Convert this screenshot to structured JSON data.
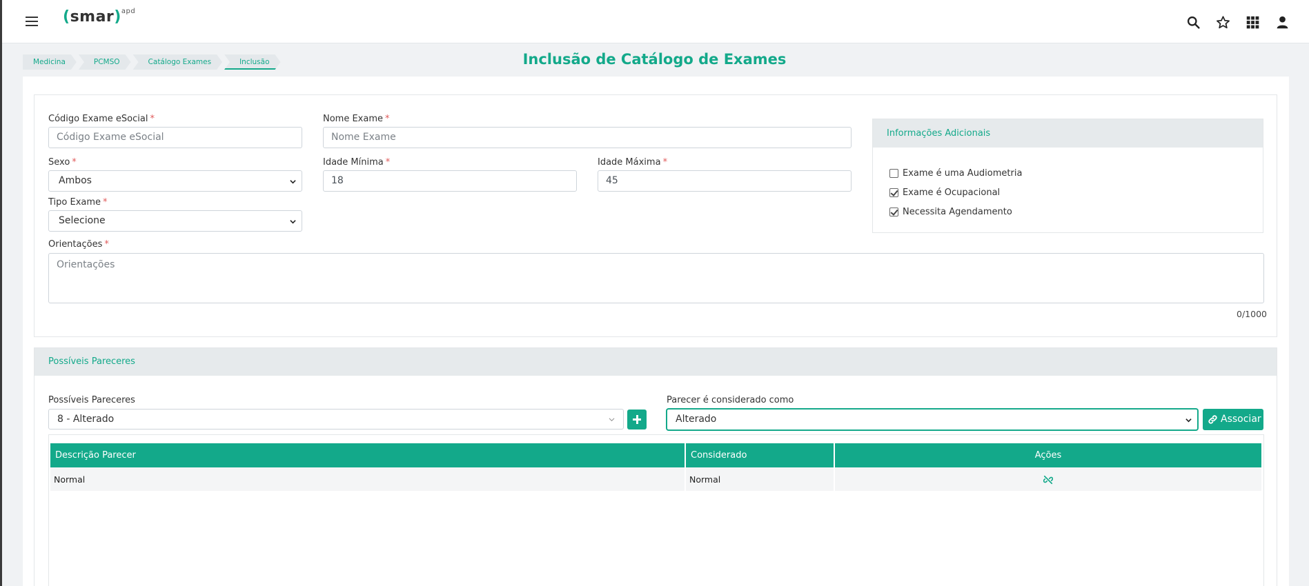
{
  "header": {
    "logo_left": "(",
    "logo_text": "smar",
    "logo_right": ")",
    "logo_sup": "apd",
    "icons": [
      "search-icon",
      "star-icon",
      "apps-grid-icon",
      "user-icon"
    ]
  },
  "breadcrumb": [
    "Medicina",
    "PCMSO",
    "Catálogo Exames",
    "Inclusão"
  ],
  "page": {
    "title": "Inclusão de Catálogo de Exames"
  },
  "form": {
    "codigo": {
      "label": "Código Exame eSocial",
      "placeholder": "Código Exame eSocial",
      "value": ""
    },
    "nome": {
      "label": "Nome Exame",
      "placeholder": "Nome Exame",
      "value": ""
    },
    "sexo": {
      "label": "Sexo",
      "value": "Ambos"
    },
    "idade_min": {
      "label": "Idade Mínima",
      "value": "18"
    },
    "idade_max": {
      "label": "Idade Máxima",
      "value": "45"
    },
    "tipo": {
      "label": "Tipo Exame",
      "value": "Selecione"
    },
    "orientacoes": {
      "label": "Orientações",
      "placeholder": "Orientações",
      "counter": "0/1000"
    },
    "required_mark": "*"
  },
  "info": {
    "title": "Informações Adicionais",
    "checks": [
      {
        "label": "Exame é uma Audiometria",
        "checked": false
      },
      {
        "label": "Exame é Ocupacional",
        "checked": true
      },
      {
        "label": "Necessita Agendamento",
        "checked": true
      }
    ]
  },
  "pareceres": {
    "title": "Possíveis Pareceres",
    "select_label": "Possíveis Pareceres",
    "select_value": "8 - Alterado",
    "considerado_label": "Parecer é considerado como",
    "considerado_value": "Alterado",
    "associar_label": "Associar",
    "table": {
      "headers": [
        "Descrição Parecer",
        "Considerado",
        "Ações"
      ],
      "rows": [
        {
          "descricao": "Normal",
          "considerado": "Normal"
        }
      ]
    }
  },
  "colors": {
    "accent": "#13a98a",
    "panel_head": "#e6eaec"
  }
}
